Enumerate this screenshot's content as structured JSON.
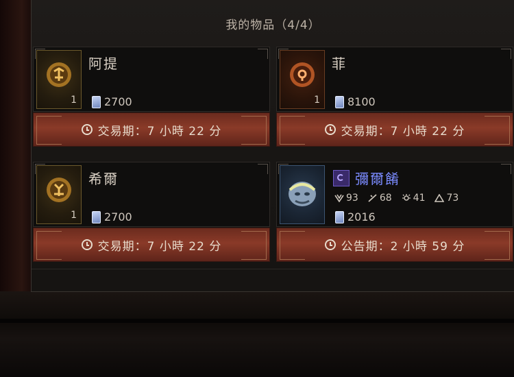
{
  "header": {
    "title": "我的物品（4/4）"
  },
  "items": [
    {
      "name": "阿提",
      "qty": "1",
      "price": "2700",
      "timer": "交易期：7 小時 22 分",
      "icon": "rune-icon"
    },
    {
      "name": "菲",
      "qty": "1",
      "price": "8100",
      "timer": "交易期：7 小時 22 分",
      "icon": "rune-icon"
    },
    {
      "name": "希爾",
      "qty": "1",
      "price": "2700",
      "timer": "交易期：7 小時 22 分",
      "icon": "rune-icon"
    },
    {
      "name": "彌爾餚",
      "price": "2016",
      "timer": "公告期：2 小時 59 分",
      "icon": "helm-icon",
      "stats": [
        "93",
        "68",
        "41",
        "73"
      ]
    }
  ],
  "colors": {
    "banner": "#8a3a28",
    "unique_name": "#7b8bff"
  }
}
